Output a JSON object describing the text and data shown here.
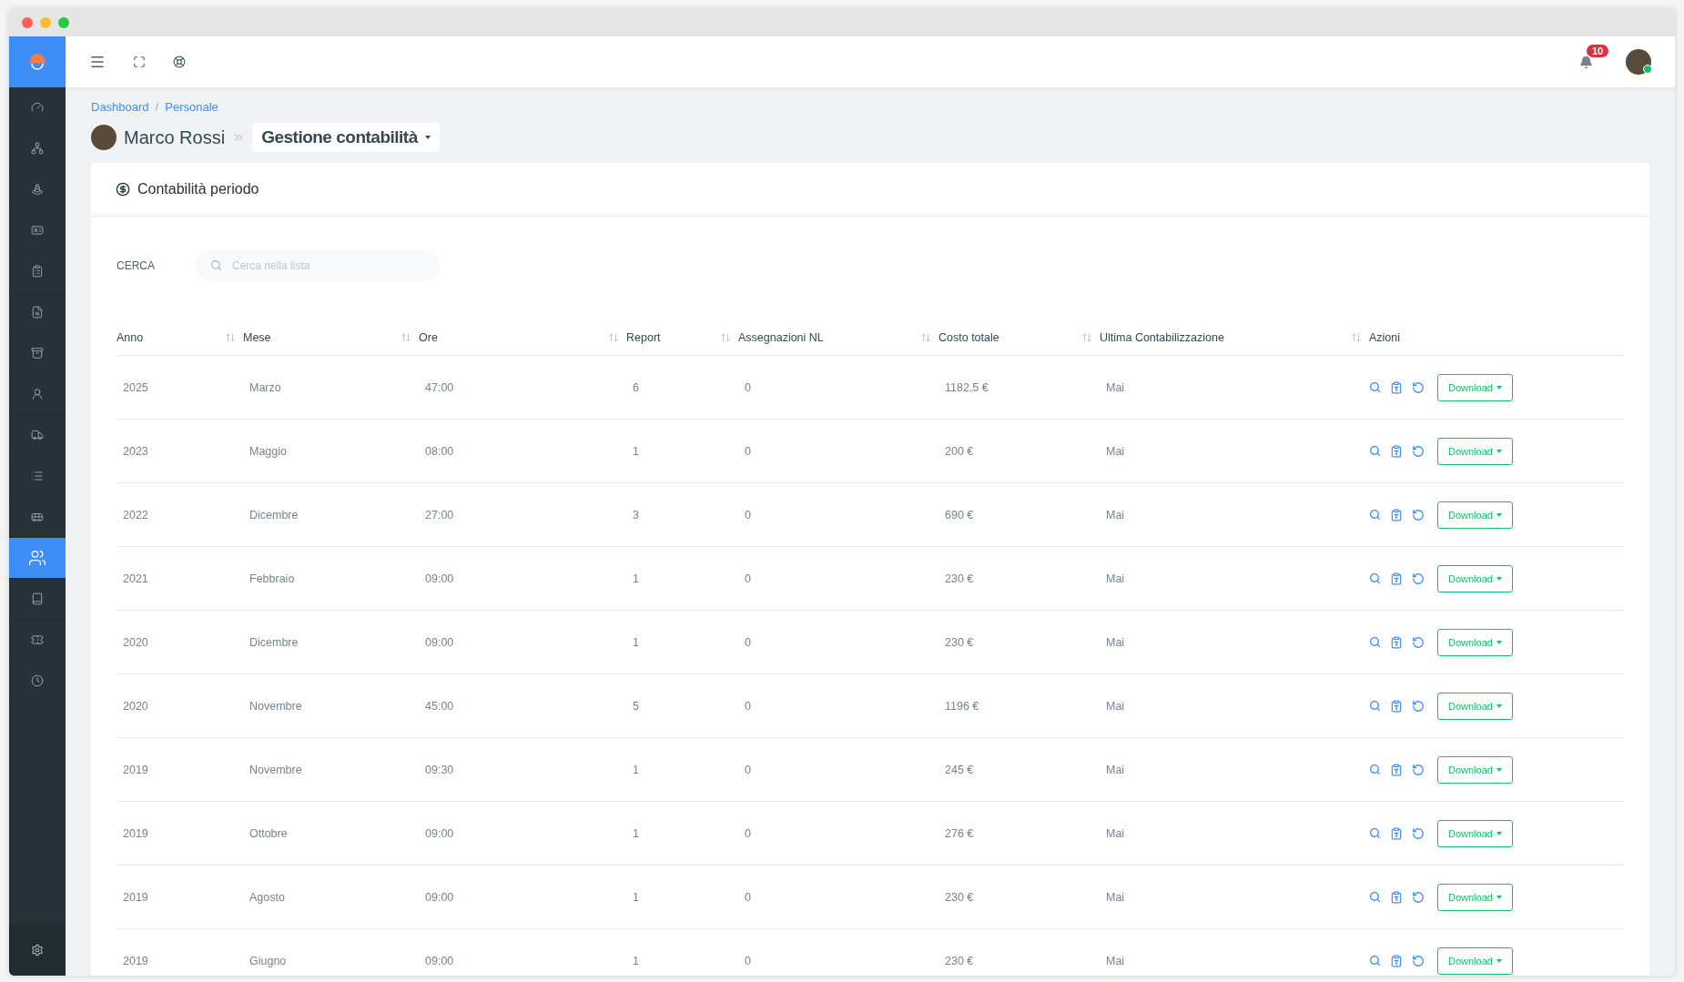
{
  "sidebar": {
    "items": [
      {
        "selected": false
      },
      {
        "selected": false
      },
      {
        "selected": false
      },
      {
        "selected": false
      },
      {
        "selected": false
      },
      {
        "selected": false
      },
      {
        "selected": false
      },
      {
        "selected": false
      },
      {
        "selected": false
      },
      {
        "selected": false
      },
      {
        "selected": false
      },
      {
        "selected": true
      },
      {
        "selected": false
      },
      {
        "selected": false
      },
      {
        "selected": false
      }
    ]
  },
  "topbar": {
    "notifications": "10",
    "online": true
  },
  "breadcrumb": {
    "separator": "/",
    "items": [
      "Dashboard",
      "Personale"
    ]
  },
  "title": {
    "person": "Marco Rossi",
    "section": "Gestione contabilità"
  },
  "card": {
    "title": "Contabilità periodo",
    "search": {
      "label": "CERCA",
      "placeholder": "Cerca nella lista"
    },
    "table": {
      "columns": [
        {
          "label": "Anno",
          "sortable": true
        },
        {
          "label": "Mese",
          "sortable": true
        },
        {
          "label": "Ore",
          "sortable": true
        },
        {
          "label": "Report",
          "sortable": true
        },
        {
          "label": "Assegnazioni NL",
          "sortable": true
        },
        {
          "label": "Costo totale",
          "sortable": true
        },
        {
          "label": "Ultima Contabilizzazione",
          "sortable": true
        },
        {
          "label": "Azioni",
          "sortable": false
        }
      ],
      "rows": [
        {
          "cells": [
            "2025",
            "Marzo",
            "47:00",
            "6",
            "0",
            "1182,5 €",
            "Mai"
          ],
          "action": "Download"
        },
        {
          "cells": [
            "2023",
            "Maggio",
            "08:00",
            "1",
            "0",
            "200 €",
            "Mai"
          ],
          "action": "Download"
        },
        {
          "cells": [
            "2022",
            "Dicembre",
            "27:00",
            "3",
            "0",
            "690 €",
            "Mai"
          ],
          "action": "Download"
        },
        {
          "cells": [
            "2021",
            "Febbraio",
            "09:00",
            "1",
            "0",
            "230 €",
            "Mai"
          ],
          "action": "Download"
        },
        {
          "cells": [
            "2020",
            "Dicembre",
            "09:00",
            "1",
            "0",
            "230 €",
            "Mai"
          ],
          "action": "Download"
        },
        {
          "cells": [
            "2020",
            "Novembre",
            "45:00",
            "5",
            "0",
            "1196 €",
            "Mai"
          ],
          "action": "Download"
        },
        {
          "cells": [
            "2019",
            "Novembre",
            "09:30",
            "1",
            "0",
            "245 €",
            "Mai"
          ],
          "action": "Download"
        },
        {
          "cells": [
            "2019",
            "Ottobre",
            "09:00",
            "1",
            "0",
            "276 €",
            "Mai"
          ],
          "action": "Download"
        },
        {
          "cells": [
            "2019",
            "Agosto",
            "09:00",
            "1",
            "0",
            "230 €",
            "Mai"
          ],
          "action": "Download"
        },
        {
          "cells": [
            "2019",
            "Giugno",
            "09:00",
            "1",
            "0",
            "230 €",
            "Mai"
          ],
          "action": "Download"
        }
      ]
    }
  }
}
